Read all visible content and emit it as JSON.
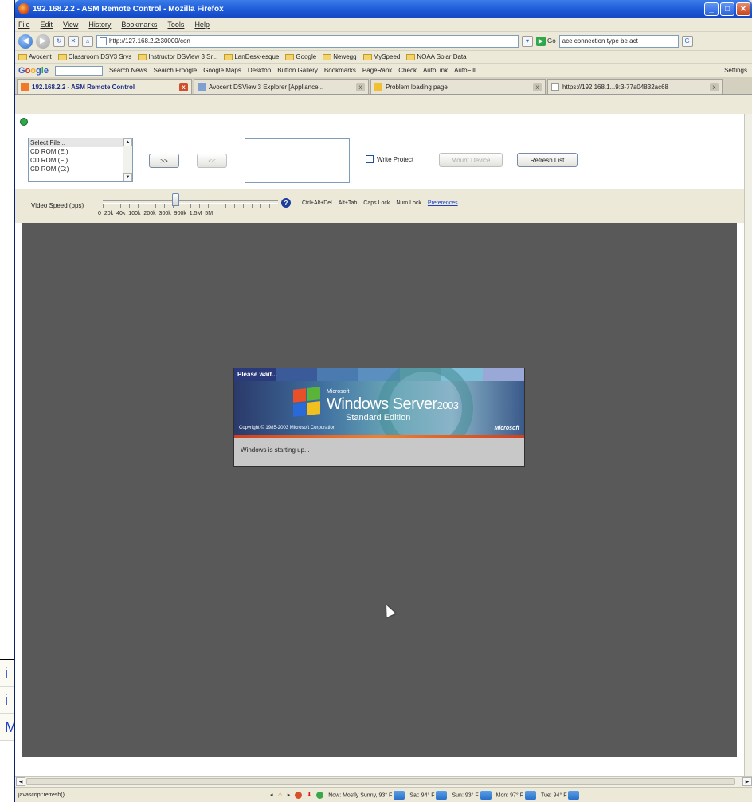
{
  "window": {
    "title": "192.168.2.2 - ASM Remote Control - Mozilla Firefox",
    "buttons": {
      "minimize": "_",
      "maximize": "□",
      "close": "✕"
    }
  },
  "menubar": [
    "File",
    "Edit",
    "View",
    "History",
    "Bookmarks",
    "Tools",
    "Help"
  ],
  "nav": {
    "back_icon": "back-arrow-icon",
    "url": "http://127.168.2.2:30000/con",
    "go_label": "Go",
    "search_value": "ace connection type be act"
  },
  "bookmarks": [
    "Avocent",
    "Classroom DSV3 Srvs",
    "Instructor DSView 3 Sr...",
    "LanDesk-esque",
    "Google",
    "Newegg",
    "MySpeed",
    "NOAA Solar Data"
  ],
  "google_toolbar": {
    "items": [
      "Search News",
      "Search Froogle",
      "Google Maps",
      "Desktop",
      "Button Gallery",
      "Bookmarks",
      "PageRank",
      "Check",
      "AutoLink",
      "AutoFill"
    ],
    "settings": "Settings"
  },
  "tabs": [
    {
      "label": "192.168.2.2 - ASM Remote Control",
      "active": true
    },
    {
      "label": "Avocent DSView 3 Explorer [Appliance...",
      "active": false
    },
    {
      "label": "Problem loading page",
      "active": false
    },
    {
      "label": "https://192.168.1...9:3-77a04832ac68",
      "active": false
    }
  ],
  "virtual_media": {
    "file_list": [
      "Select File...",
      "CD ROM (E:)",
      "CD ROM (F:)",
      "CD ROM (G:)"
    ],
    "add_label": ">>",
    "remove_label": "<<",
    "write_protect_label": "Write Protect",
    "mount_label": "Mount Device",
    "refresh_label": "Refresh List"
  },
  "speed": {
    "label": "Video Speed (bps)",
    "ticks": "0   20k   40k  100k  200k  300k  900k  1.5M   5M",
    "keys": [
      "Ctrl+Alt+Del",
      "Alt+Tab",
      "Caps Lock",
      "Num Lock"
    ],
    "preferences": "Preferences"
  },
  "splash": {
    "please_wait": "Please wait...",
    "brand_small": "Microsoft",
    "brand": "Windows Server",
    "year": "2003",
    "edition": "Standard Edition",
    "copyright": "Copyright © 1985-2003 Microsoft Corporation",
    "ms": "Microsoft",
    "message": "Windows is starting up..."
  },
  "status": {
    "text": "javascript:refresh()",
    "weather_now": "Now: Mostly Sunny, 93° F",
    "forecast": [
      "Sat: 94° F",
      "Sun: 93° F",
      "Mon: 97° F",
      "Tue: 94° F"
    ]
  },
  "left_sliver": [
    "i",
    "i",
    "M"
  ]
}
